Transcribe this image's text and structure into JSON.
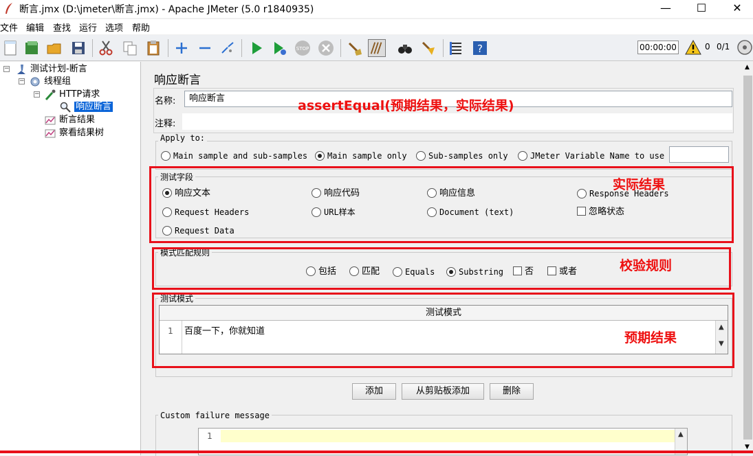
{
  "window": {
    "title": "断言.jmx (D:\\jmeter\\断言.jmx) - Apache JMeter (5.0 r1840935)",
    "minimize": "—",
    "maximize": "☐",
    "close": "✕"
  },
  "menu": [
    "文件",
    "编辑",
    "查找",
    "运行",
    "选项",
    "帮助"
  ],
  "toolbar": {
    "timer": "00:00:00",
    "warning_count": "0",
    "thread_ratio": "0/1"
  },
  "tree": {
    "items": [
      {
        "label": "测试计划-断言"
      },
      {
        "label": "线程组"
      },
      {
        "label": "HTTP请求"
      },
      {
        "label": "响应断言"
      },
      {
        "label": "断言结果"
      },
      {
        "label": "察看结果树"
      }
    ]
  },
  "panel": {
    "title": "响应断言",
    "name_label": "名称:",
    "name_value": "响应断言",
    "comment_label": "注释:",
    "comment_value": "",
    "apply_to": {
      "title": "Apply to:",
      "options": [
        "Main sample and sub-samples",
        "Main sample only",
        "Sub-samples only",
        "JMeter Variable Name to use"
      ],
      "selected": "Main sample only",
      "variable_value": ""
    },
    "test_field": {
      "title": "测试字段",
      "options": [
        "响应文本",
        "响应代码",
        "响应信息",
        "Response Headers",
        "Request Headers",
        "URL样本",
        "Document (text)",
        "Request Data"
      ],
      "selected": "响应文本",
      "ignore_status": "忽略状态"
    },
    "matching_rules": {
      "title": "模式匹配规则",
      "options": [
        "包括",
        "匹配",
        "Equals",
        "Substring"
      ],
      "selected": "Substring",
      "checkboxes": [
        "否",
        "或者"
      ]
    },
    "patterns": {
      "title": "测试模式",
      "column_header": "测试模式",
      "rows": [
        {
          "line": "1",
          "text": "百度一下，你就知道"
        }
      ]
    },
    "buttons": {
      "add": "添加",
      "add_clipboard": "从剪贴板添加",
      "delete": "删除"
    },
    "custom_failure": {
      "title": "Custom failure message",
      "line": "1",
      "value": ""
    }
  },
  "annotations": {
    "assert_equal": "assertEqual(预期结果，实际结果)",
    "actual": "实际结果",
    "rule": "校验规则",
    "expected": "预期结果"
  },
  "colors": {
    "annotation_red": "#e8101a",
    "selected_blue": "#0a64d8",
    "editor_yellow": "#ffffcc"
  }
}
